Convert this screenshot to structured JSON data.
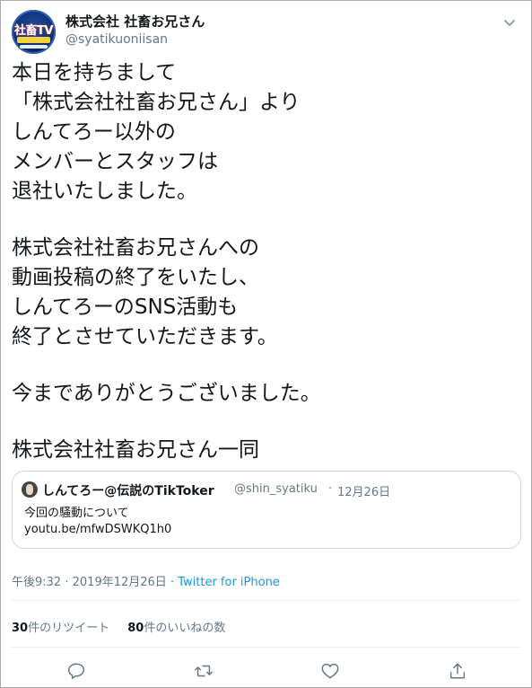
{
  "author": {
    "display_name": "株式会社 社畜お兄さん",
    "handle": "@syatikuoniisan",
    "avatar_text": "社畜TV"
  },
  "tweet": {
    "lines": [
      "本日を持ちまして",
      "「株式会社社畜お兄さん」より",
      "しんてろー以外の",
      "メンバーとスタッフは",
      "退社いたしました。",
      "株式会社社畜お兄さんへの",
      "動画投稿の終了をいたし、",
      "しんてろーのSNS活動も",
      "終了とさせていただきます。",
      "今までありがとうございました。",
      "株式会社社畜お兄さん一同"
    ]
  },
  "quote": {
    "name": "しんてろー@伝説のTikToker",
    "handle": "@shin_syatiku",
    "separator": "·",
    "date": "12月26日",
    "text": "今回の騒動について",
    "link": "youtu.be/mfwDSWKQ1h0"
  },
  "meta": {
    "time": "午後9:32",
    "separator": "·",
    "date": "2019年12月26日",
    "source": "Twitter for iPhone"
  },
  "stats": {
    "retweets_count": "30",
    "retweets_label": "件のリツイート",
    "likes_count": "80",
    "likes_label": "件のいいねの数"
  },
  "colors": {
    "text": "#14171a",
    "secondary": "#657786",
    "link": "#1b95e0",
    "border": "#ccd6dd"
  },
  "icons": {
    "caret": "chevron-down-icon",
    "reply": "reply-icon",
    "retweet": "retweet-icon",
    "like": "heart-icon",
    "share": "share-icon"
  }
}
